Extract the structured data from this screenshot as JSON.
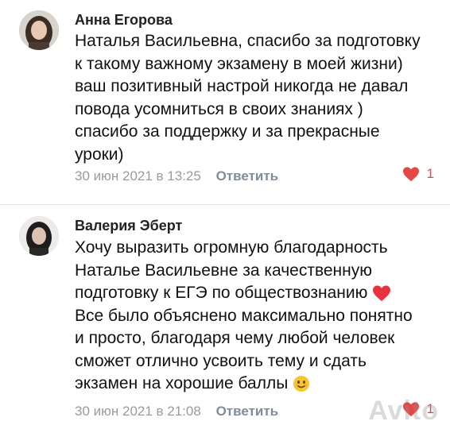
{
  "comments": [
    {
      "author": "Анна Егорова",
      "lines": [
        "Наталья Васильевна, спасибо за подготовку",
        "к такому важному экзамену в моей жизни)",
        "ваш позитивный настрой никогда не давал",
        "повода усомниться в своих знаниях )",
        "спасибо за поддержку и за прекрасные",
        "уроки)"
      ],
      "date": "30 июн 2021 в 13:25",
      "reply_label": "Ответить",
      "likes": "1",
      "avatar_icon": "user-avatar"
    },
    {
      "author": "Валерия Эберт",
      "lines": [
        "Хочу выразить огромную благодарность",
        "Наталье Васильевне за качественную",
        "подготовку к ЕГЭ по обществознанию",
        "Все было объяснено максимально понятно",
        "и просто, благодаря чему любой человек",
        "сможет отлично усвоить тему и сдать",
        "экзамен на хорошие баллы"
      ],
      "date": "30 июн 2021 в 21:08",
      "reply_label": "Ответить",
      "likes": "1",
      "avatar_icon": "user-avatar"
    }
  ],
  "watermark": "Avito",
  "colors": {
    "heart": "#e64646",
    "meta": "#9b9b9b",
    "reply": "#818c99"
  }
}
